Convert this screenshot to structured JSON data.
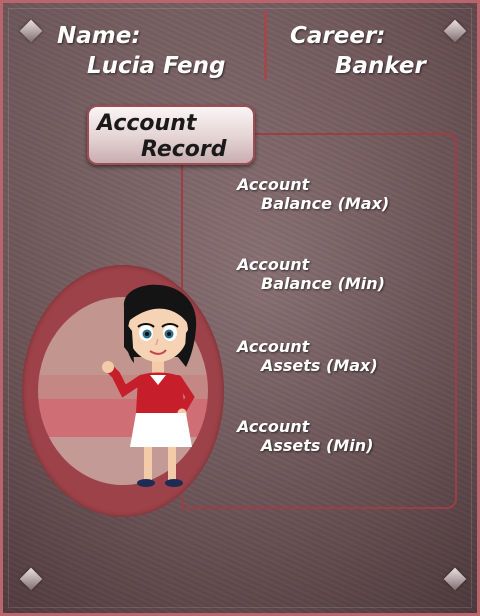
{
  "profile": {
    "name_label": "Name:",
    "name_value": "Lucia Feng",
    "career_label": "Career:",
    "career_value": "Banker"
  },
  "record_button": {
    "line1": "Account",
    "line2": "Record"
  },
  "stats": [
    {
      "line1": "Account",
      "line2": "Balance (Max)"
    },
    {
      "line1": "Account",
      "line2": "Balance (Min)"
    },
    {
      "line1": "Account",
      "line2": "Assets (Max)"
    },
    {
      "line1": "Account",
      "line2": "Assets (Min)"
    }
  ],
  "colors": {
    "frame": "#b8666c",
    "accent": "#9c3e45",
    "oval": "#9d4248",
    "text": "#ffffff"
  },
  "icons": [
    "corner-bolt-icon",
    "player-avatar"
  ]
}
